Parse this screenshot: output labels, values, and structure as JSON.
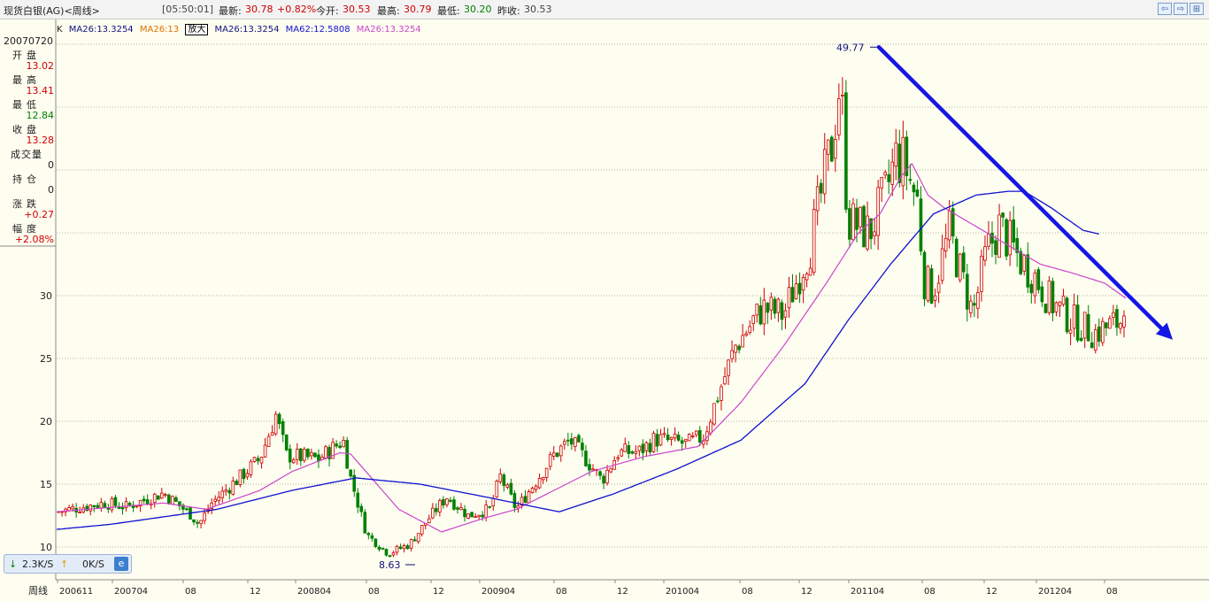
{
  "header": {
    "symbol": "现货白银(AG)<周线>",
    "time": "[05:50:01]",
    "last_label": "最新:",
    "last_value": "30.78",
    "change_pct": "+0.82%",
    "open_label": "今开:",
    "open_value": "30.53",
    "high_label": "最高:",
    "high_value": "30.79",
    "low_label": "最低:",
    "low_value": "30.20",
    "prev_label": "昨收:",
    "prev_value": "30.53"
  },
  "window_buttons": [
    "⇦",
    "⇨",
    "⊞"
  ],
  "ma_legend": {
    "k": "K",
    "ma1": "MA26:13.3254",
    "ma2": "MA26:13",
    "zoom": "放大",
    "ma3": "MA26:13.3254",
    "ma4": "MA62:12.5808",
    "ma5": "MA26:13.3254"
  },
  "info_panel": {
    "date": "20070720",
    "open_label": "开盘",
    "open": "13.02",
    "high_label": "最高",
    "high": "13.41",
    "low_label": "最低",
    "low": "12.84",
    "close_label": "收盘",
    "close": "13.28",
    "volume_label": "成交量",
    "volume": "0",
    "position_label": "持仓",
    "position": "0",
    "change_label": "涨跌",
    "change": "+0.27",
    "amplitude_label": "幅度",
    "amplitude": "+2.08%"
  },
  "status_bar": {
    "down": "2.3K/S",
    "up": "0K/S",
    "icon": "ie-icon"
  },
  "colors": {
    "up": "#d00000",
    "down": "#008000",
    "ma_short": "#cc44cc",
    "ma_long": "#1010d0",
    "trendline": "#1515e6",
    "grid": "#b8b8a0"
  },
  "chart_data": {
    "type": "candlestick",
    "x_axis_label": "周线",
    "x_tick_labels": [
      "200611",
      "200704",
      "08",
      "12",
      "200804",
      "08",
      "12",
      "200904",
      "08",
      "12",
      "201004",
      "08",
      "12",
      "201104",
      "08",
      "12",
      "201204",
      "08"
    ],
    "ylim": [
      10,
      50
    ],
    "y_ticks": [
      10,
      15,
      20,
      25,
      30
    ],
    "annotations": [
      {
        "text": "49.77",
        "x": "201104",
        "y": 49.77
      },
      {
        "text": "8.63",
        "x": "200811",
        "y": 8.63
      }
    ],
    "trendline": {
      "from": {
        "x": "201104",
        "y": 49.77
      },
      "to": {
        "x": "201210",
        "y": 26.5
      }
    },
    "close_path": [
      {
        "t": 0.0,
        "v": 12.8
      },
      {
        "t": 4.5,
        "v": 13.5
      },
      {
        "t": 6.5,
        "v": 13.2
      },
      {
        "t": 10.0,
        "v": 14.3
      },
      {
        "t": 12.5,
        "v": 12.6
      },
      {
        "t": 13.3,
        "v": 11.8
      },
      {
        "t": 14.5,
        "v": 13.5
      },
      {
        "t": 19.0,
        "v": 17.0
      },
      {
        "t": 20.5,
        "v": 20.5
      },
      {
        "t": 21.5,
        "v": 17.3
      },
      {
        "t": 24.5,
        "v": 17.0
      },
      {
        "t": 26.8,
        "v": 18.5
      },
      {
        "t": 27.5,
        "v": 15.5
      },
      {
        "t": 29.0,
        "v": 11.0
      },
      {
        "t": 31.0,
        "v": 9.5
      },
      {
        "t": 33.0,
        "v": 10.2
      },
      {
        "t": 35.0,
        "v": 12.5
      },
      {
        "t": 36.5,
        "v": 14.0
      },
      {
        "t": 38.5,
        "v": 12.5
      },
      {
        "t": 40.5,
        "v": 13.0
      },
      {
        "t": 41.5,
        "v": 15.6
      },
      {
        "t": 43.0,
        "v": 13.0
      },
      {
        "t": 46.5,
        "v": 17.3
      },
      {
        "t": 48.0,
        "v": 18.5
      },
      {
        "t": 49.5,
        "v": 17.0
      },
      {
        "t": 51.0,
        "v": 15.3
      },
      {
        "t": 52.5,
        "v": 17.5
      },
      {
        "t": 54.5,
        "v": 17.6
      },
      {
        "t": 56.0,
        "v": 18.6
      },
      {
        "t": 59.0,
        "v": 18.2
      },
      {
        "t": 60.5,
        "v": 18.8
      },
      {
        "t": 63.5,
        "v": 26.0
      },
      {
        "t": 66.0,
        "v": 29.0
      },
      {
        "t": 68.0,
        "v": 28.5
      },
      {
        "t": 70.5,
        "v": 34.0
      },
      {
        "t": 72.5,
        "v": 42.0
      },
      {
        "t": 73.3,
        "v": 47.5
      },
      {
        "t": 74.0,
        "v": 36.0
      },
      {
        "t": 76.0,
        "v": 35.0
      },
      {
        "t": 77.5,
        "v": 38.0
      },
      {
        "t": 78.5,
        "v": 41.0
      },
      {
        "t": 79.3,
        "v": 40.5
      },
      {
        "t": 80.5,
        "v": 37.5
      },
      {
        "t": 81.2,
        "v": 31.0
      },
      {
        "t": 82.0,
        "v": 30.5
      },
      {
        "t": 83.5,
        "v": 35.0
      },
      {
        "t": 84.5,
        "v": 32.0
      },
      {
        "t": 85.7,
        "v": 28.5
      },
      {
        "t": 87.0,
        "v": 33.5
      },
      {
        "t": 88.2,
        "v": 35.5
      },
      {
        "t": 90.0,
        "v": 33.0
      },
      {
        "t": 91.5,
        "v": 31.5
      },
      {
        "t": 93.0,
        "v": 29.5
      },
      {
        "t": 95.0,
        "v": 28.0
      },
      {
        "t": 97.0,
        "v": 27.0
      },
      {
        "t": 99.5,
        "v": 28.0
      },
      {
        "t": 100.0,
        "v": 30.8
      }
    ],
    "ma_short_path": [
      {
        "t": 0.0,
        "v": 12.8
      },
      {
        "t": 10.0,
        "v": 13.5
      },
      {
        "t": 14.0,
        "v": 13.0
      },
      {
        "t": 19.0,
        "v": 14.5
      },
      {
        "t": 22.0,
        "v": 16.0
      },
      {
        "t": 26.5,
        "v": 17.5
      },
      {
        "t": 27.5,
        "v": 17.4
      },
      {
        "t": 32.0,
        "v": 13.0
      },
      {
        "t": 36.0,
        "v": 11.2
      },
      {
        "t": 40.0,
        "v": 12.3
      },
      {
        "t": 43.0,
        "v": 13.0
      },
      {
        "t": 50.0,
        "v": 16.0
      },
      {
        "t": 55.0,
        "v": 17.2
      },
      {
        "t": 60.0,
        "v": 18.0
      },
      {
        "t": 64.0,
        "v": 21.5
      },
      {
        "t": 68.0,
        "v": 26.0
      },
      {
        "t": 72.0,
        "v": 31.0
      },
      {
        "t": 75.0,
        "v": 35.0
      },
      {
        "t": 77.0,
        "v": 36.5
      },
      {
        "t": 79.0,
        "v": 39.5
      },
      {
        "t": 80.0,
        "v": 40.5
      },
      {
        "t": 81.5,
        "v": 38.0
      },
      {
        "t": 83.0,
        "v": 37.0
      },
      {
        "t": 86.0,
        "v": 35.5
      },
      {
        "t": 89.0,
        "v": 34.0
      },
      {
        "t": 92.0,
        "v": 32.5
      },
      {
        "t": 95.0,
        "v": 31.8
      },
      {
        "t": 98.0,
        "v": 31.0
      },
      {
        "t": 100.0,
        "v": 29.8
      }
    ],
    "ma_long_path": [
      {
        "t": 0.0,
        "v": 11.4
      },
      {
        "t": 5.0,
        "v": 11.8
      },
      {
        "t": 10.0,
        "v": 12.4
      },
      {
        "t": 15.0,
        "v": 13.0
      },
      {
        "t": 22.0,
        "v": 14.5
      },
      {
        "t": 28.0,
        "v": 15.5
      },
      {
        "t": 34.0,
        "v": 15.0
      },
      {
        "t": 40.0,
        "v": 14.0
      },
      {
        "t": 47.0,
        "v": 12.8
      },
      {
        "t": 52.0,
        "v": 14.2
      },
      {
        "t": 58.0,
        "v": 16.2
      },
      {
        "t": 64.0,
        "v": 18.5
      },
      {
        "t": 70.0,
        "v": 23.0
      },
      {
        "t": 74.0,
        "v": 28.0
      },
      {
        "t": 78.0,
        "v": 32.5
      },
      {
        "t": 82.0,
        "v": 36.5
      },
      {
        "t": 86.0,
        "v": 38.0
      },
      {
        "t": 89.0,
        "v": 38.3
      },
      {
        "t": 90.5,
        "v": 38.3
      },
      {
        "t": 93.0,
        "v": 37.0
      },
      {
        "t": 96.0,
        "v": 35.2
      },
      {
        "t": 97.5,
        "v": 34.9
      }
    ]
  }
}
